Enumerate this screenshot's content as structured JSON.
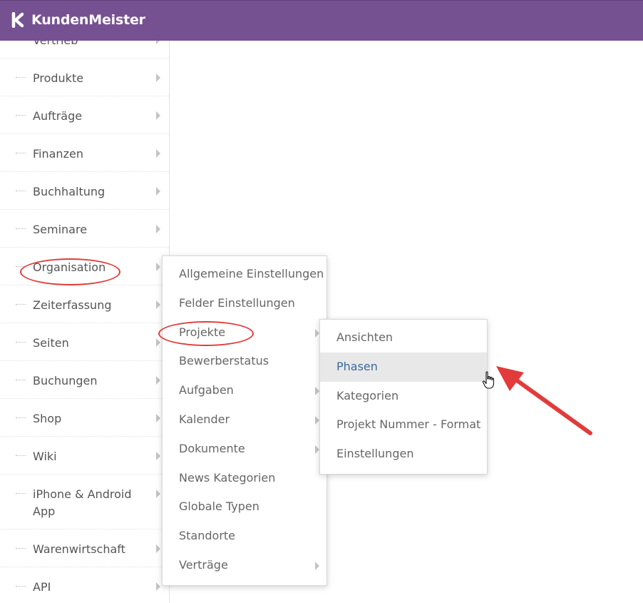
{
  "app": {
    "name": "KundenMeister",
    "header_color": "#765192"
  },
  "sidebar": {
    "items": [
      {
        "label": "Vertrieb",
        "has_submenu": true
      },
      {
        "label": "Produkte",
        "has_submenu": true
      },
      {
        "label": "Aufträge",
        "has_submenu": true
      },
      {
        "label": "Finanzen",
        "has_submenu": true
      },
      {
        "label": "Buchhaltung",
        "has_submenu": true
      },
      {
        "label": "Seminare",
        "has_submenu": true
      },
      {
        "label": "Organisation",
        "has_submenu": true,
        "highlighted": true
      },
      {
        "label": "Zeiterfassung",
        "has_submenu": true
      },
      {
        "label": "Seiten",
        "has_submenu": true
      },
      {
        "label": "Buchungen",
        "has_submenu": true
      },
      {
        "label": "Shop",
        "has_submenu": true
      },
      {
        "label": "Wiki",
        "has_submenu": true
      },
      {
        "label": "iPhone & Android App",
        "has_submenu": true
      },
      {
        "label": "Warenwirtschaft",
        "has_submenu": true
      },
      {
        "label": "API",
        "has_submenu": true
      }
    ]
  },
  "organisation_menu": {
    "items": [
      {
        "label": "Allgemeine Einstellungen",
        "has_submenu": false
      },
      {
        "label": "Felder Einstellungen",
        "has_submenu": false
      },
      {
        "label": "Projekte",
        "has_submenu": true,
        "highlighted": true
      },
      {
        "label": "Bewerberstatus",
        "has_submenu": false
      },
      {
        "label": "Aufgaben",
        "has_submenu": true
      },
      {
        "label": "Kalender",
        "has_submenu": true
      },
      {
        "label": "Dokumente",
        "has_submenu": true
      },
      {
        "label": "News Kategorien",
        "has_submenu": false
      },
      {
        "label": "Globale Typen",
        "has_submenu": false
      },
      {
        "label": "Standorte",
        "has_submenu": false
      },
      {
        "label": "Verträge",
        "has_submenu": true
      }
    ]
  },
  "projekte_menu": {
    "items": [
      {
        "label": "Ansichten",
        "active": false
      },
      {
        "label": "Phasen",
        "active": true
      },
      {
        "label": "Kategorien",
        "active": false
      },
      {
        "label": "Projekt Nummer - Format",
        "active": false
      },
      {
        "label": "Einstellungen",
        "active": false
      }
    ]
  },
  "annotation": {
    "color": "#e23b3b"
  }
}
